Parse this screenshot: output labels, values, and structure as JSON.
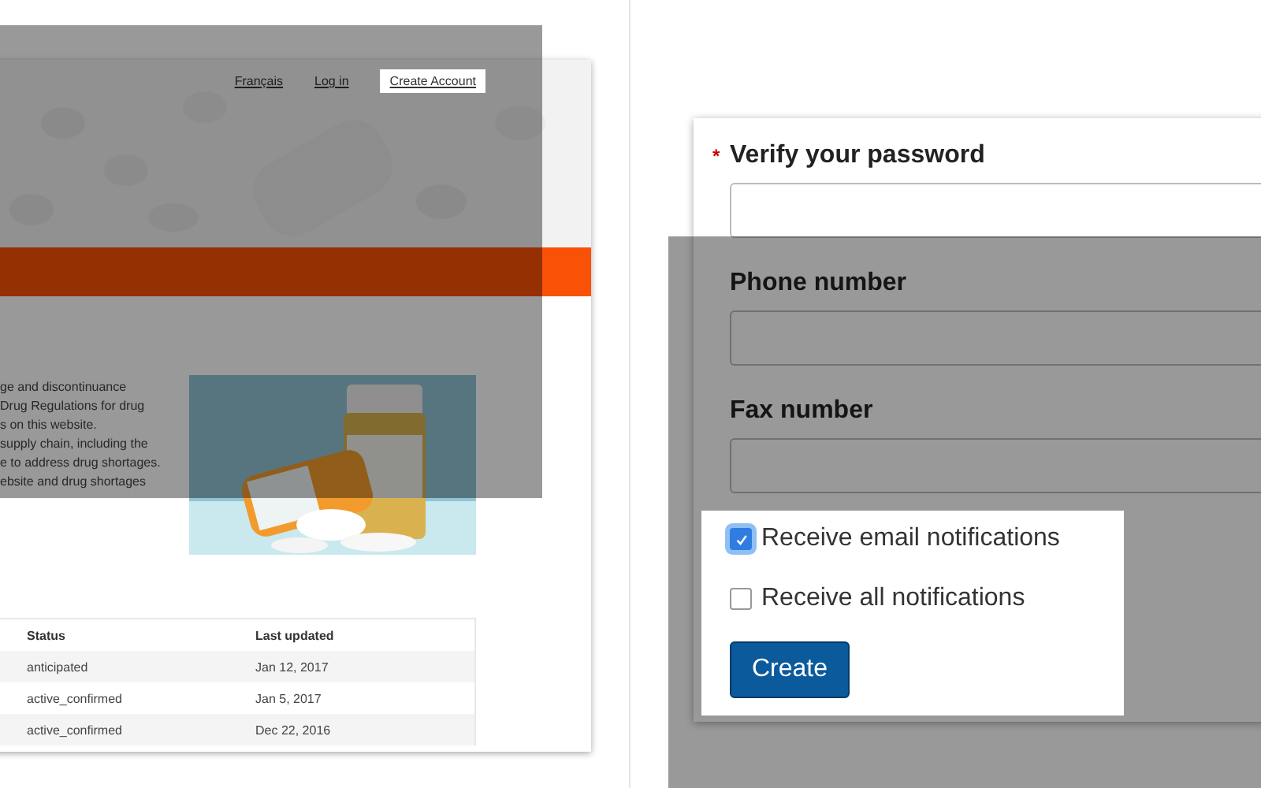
{
  "left_page": {
    "nav_links": [
      {
        "label": "Français",
        "highlighted": false
      },
      {
        "label": "Log in",
        "highlighted": false
      },
      {
        "label": "Create Account",
        "highlighted": true
      }
    ],
    "intro_lines": [
      "ge and discontinuance",
      "Drug Regulations for drug",
      "s on this website.",
      "supply chain, including the",
      "e to address drug shortages.",
      "ebsite and drug shortages"
    ],
    "table": {
      "columns": [
        "Status",
        "Last updated"
      ],
      "rows": [
        [
          "anticipated",
          "Jan 12, 2017"
        ],
        [
          "active_confirmed",
          "Jan 5, 2017"
        ],
        [
          "active_confirmed",
          "Dec 22, 2016"
        ]
      ]
    }
  },
  "right_form": {
    "fields": [
      {
        "label": "Verify your password",
        "required_mark": "*"
      },
      {
        "label": "Phone number"
      },
      {
        "label": "Fax number"
      }
    ],
    "checkboxes": [
      {
        "label": "Receive email notifications",
        "checked": true,
        "focused": true
      },
      {
        "label": "Receive all notifications",
        "checked": false,
        "focused": false
      }
    ],
    "submit": "Create"
  }
}
